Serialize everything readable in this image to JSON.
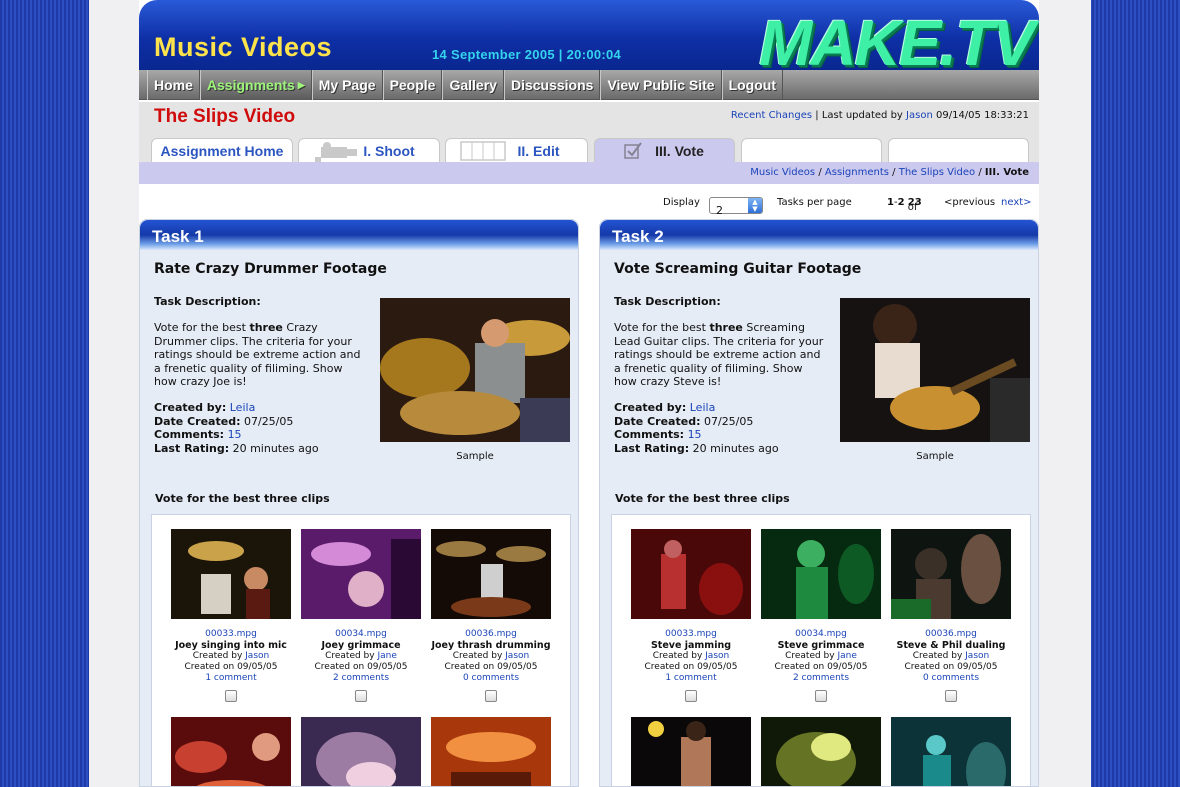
{
  "header": {
    "section_title": "Music Videos",
    "datetime": "14 September 2005 | 20:00:04",
    "logo_text": "MAKE.TV"
  },
  "nav": [
    "Home",
    "Assignments",
    "My Page",
    "People",
    "Gallery",
    "Discussions",
    "View Public Site",
    "Logout"
  ],
  "nav_active": "Assignments",
  "page": {
    "title": "The Slips Video",
    "recent_changes": "Recent Changes",
    "updated_prefix": "| Last updated by",
    "updated_user": "Jason",
    "updated_time": "09/14/05 18:33:21"
  },
  "tabs": [
    "Assignment Home",
    "I. Shoot",
    "II. Edit",
    "III. Vote"
  ],
  "tab_active": "III. Vote",
  "breadcrumb": {
    "items": [
      "Music Videos",
      "Assignments",
      "The Slips Video"
    ],
    "sep": "/",
    "current": "III. Vote"
  },
  "pager": {
    "display_label": "Display",
    "display_value": "2",
    "per_page_label": "Tasks per page",
    "range_from": "1",
    "range_to": "2",
    "of": "of",
    "total": "23",
    "previous": "<previous",
    "next": "next>"
  },
  "labels": {
    "task_description": "Task Description:",
    "created_by": "Created by:",
    "date_created": "Date Created:",
    "comments": "Comments:",
    "last_rating": "Last Rating:",
    "sample": "Sample",
    "vote_heading": "Vote for the best three clips",
    "created_by_small": "Created by",
    "created_on": "Created on"
  },
  "tasks": [
    {
      "header": "Task 1",
      "title": "Rate Crazy Drummer Footage",
      "desc_pre": "Vote for the best ",
      "desc_bold": "three",
      "desc_post": " Crazy Drummer clips. The criteria for your ratings should be extreme action and a frenetic quality of filiming. Show how crazy Joe is!",
      "created_by": "Leila",
      "date_created": "07/25/05",
      "comments": "15",
      "last_rating": "20 minutes ago",
      "clips": [
        {
          "file": "00033.mpg",
          "name": "Joey singing into mic",
          "author": "Jason",
          "date": "09/05/05",
          "comments": "1 comment"
        },
        {
          "file": "00034.mpg",
          "name": "Joey grimmace",
          "author": "Jane",
          "date": "09/05/05",
          "comments": "2 comments"
        },
        {
          "file": "00036.mpg",
          "name": "Joey thrash drumming",
          "author": "Jason",
          "date": "09/05/05",
          "comments": "0 comments"
        }
      ]
    },
    {
      "header": "Task 2",
      "title": "Vote Screaming Guitar Footage",
      "desc_pre": "Vote for the best ",
      "desc_bold": "three",
      "desc_post": " Screaming Lead Guitar clips. The criteria for your ratings should be extreme action and a frenetic quality of filiming. Show how crazy Steve is!",
      "created_by": "Leila",
      "date_created": "07/25/05",
      "comments": "15",
      "last_rating": "20 minutes ago",
      "clips": [
        {
          "file": "00033.mpg",
          "name": "Steve jamming",
          "author": "Jason",
          "date": "09/05/05",
          "comments": "1 comment"
        },
        {
          "file": "00034.mpg",
          "name": "Steve grimmace",
          "author": "Jane",
          "date": "09/05/05",
          "comments": "2 comments"
        },
        {
          "file": "00036.mpg",
          "name": "Steve & Phil  dualing",
          "author": "Jason",
          "date": "09/05/05",
          "comments": "0 comments"
        }
      ]
    }
  ]
}
